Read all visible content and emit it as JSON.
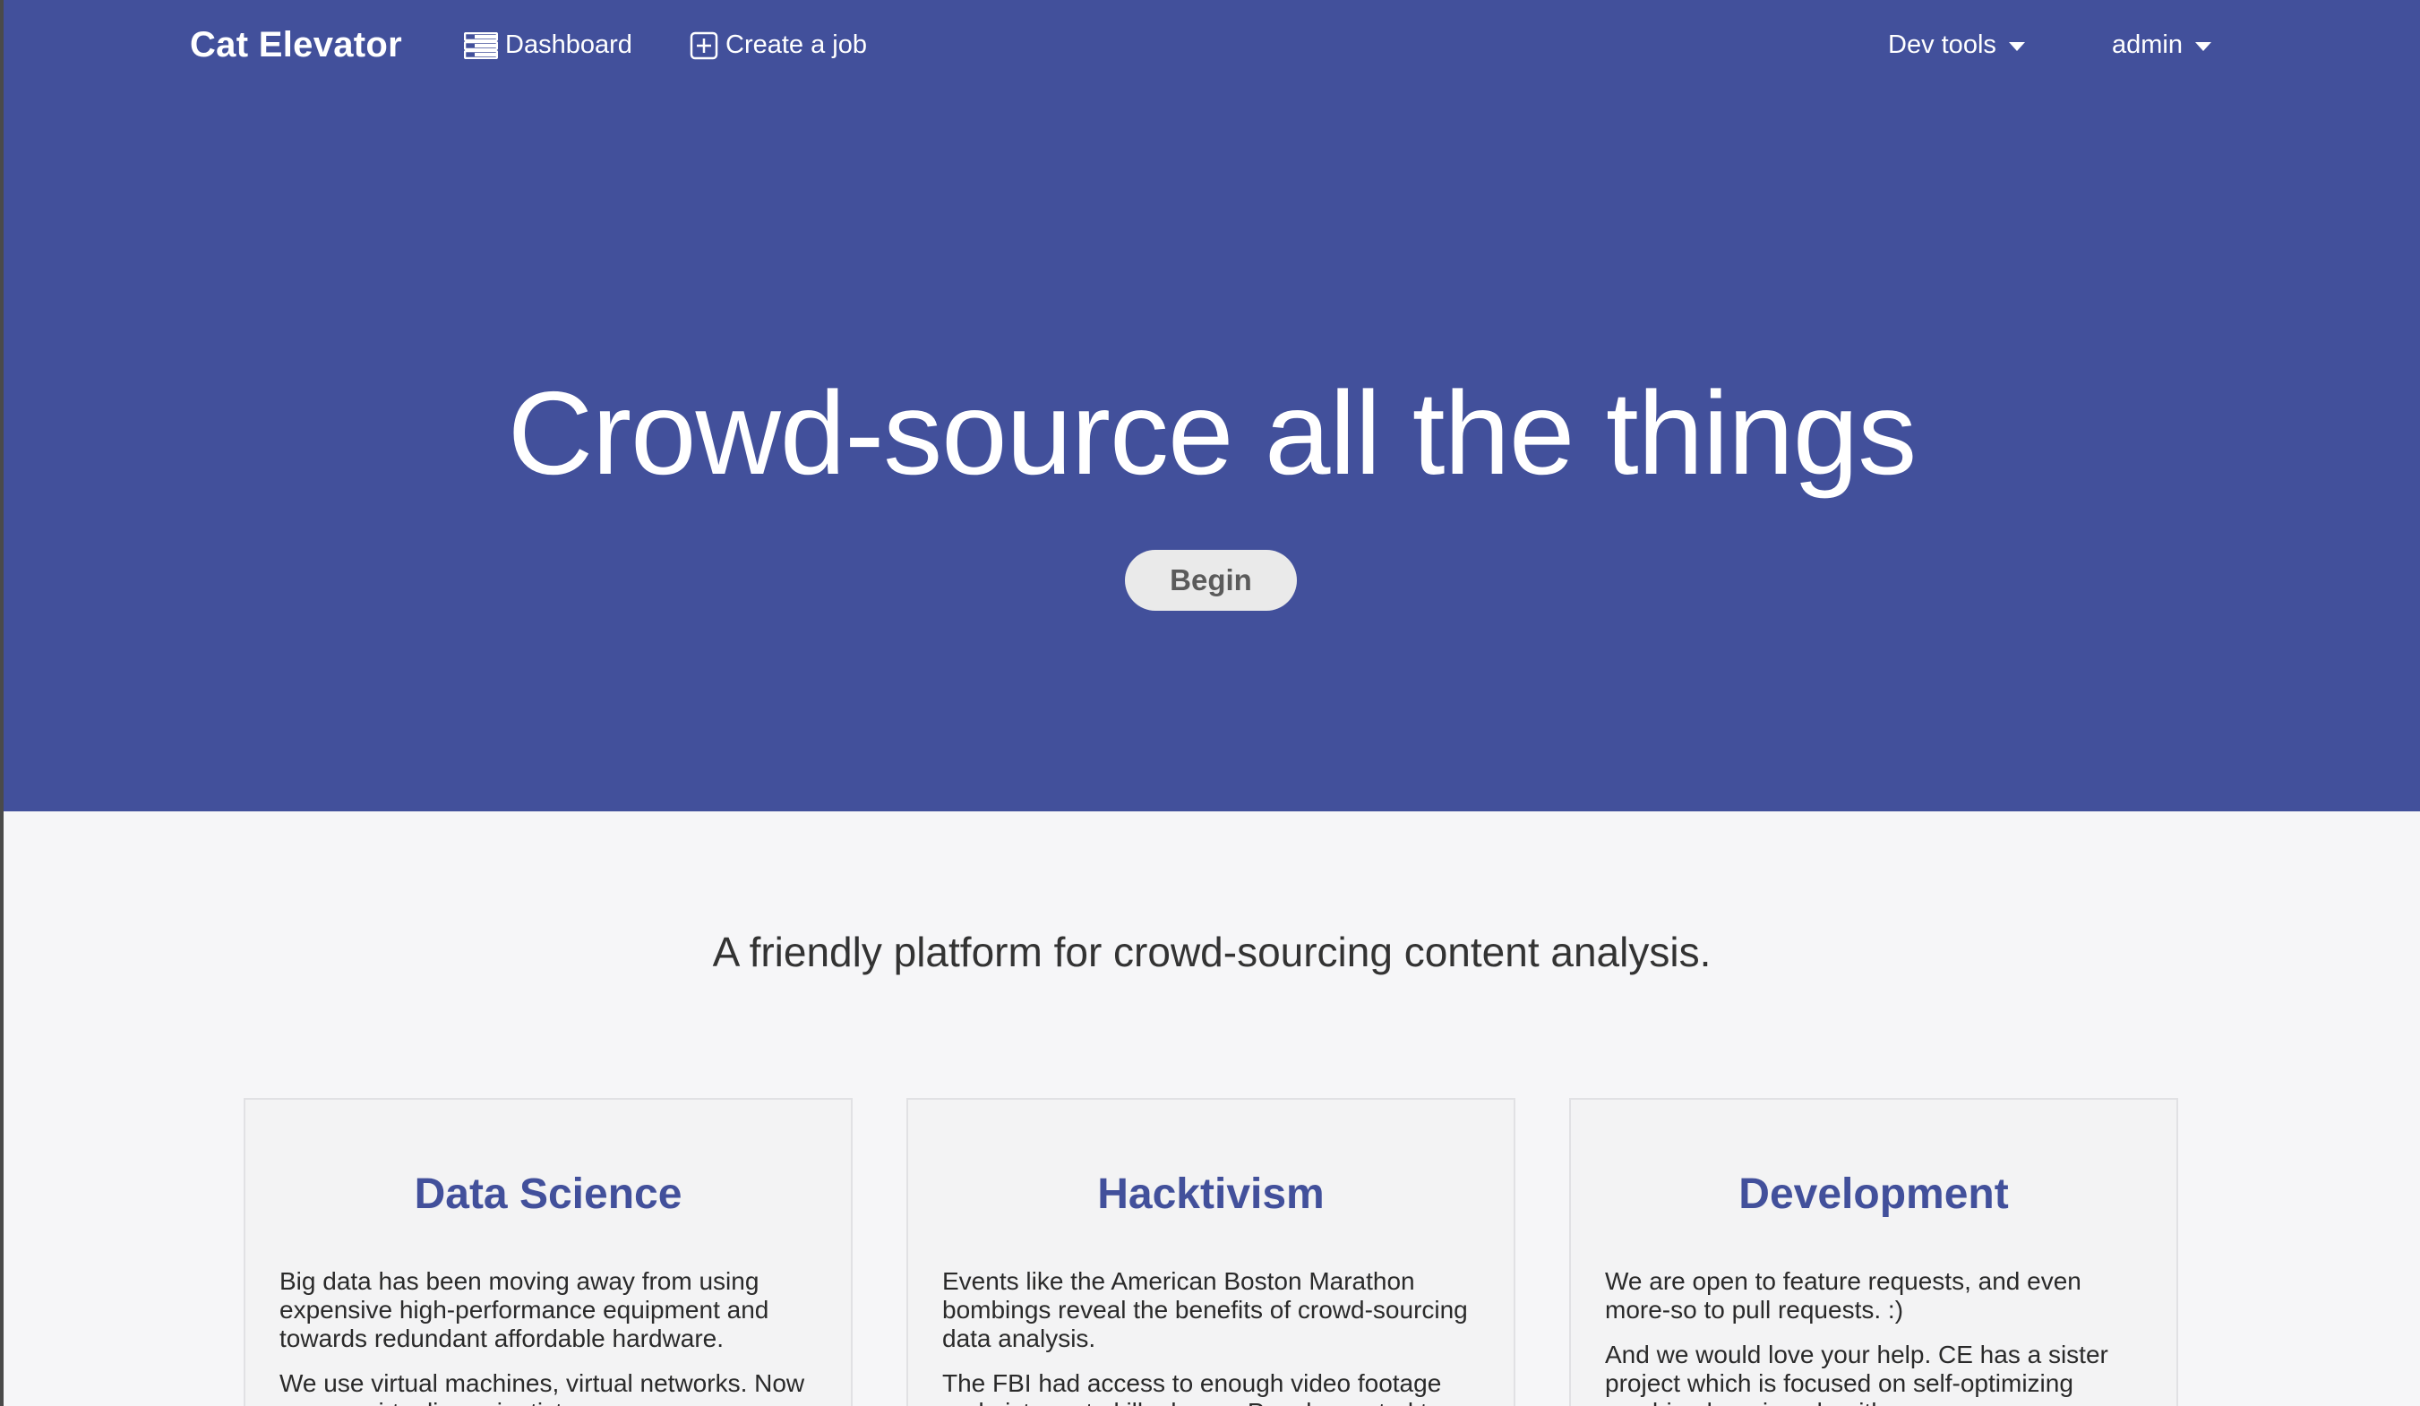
{
  "nav": {
    "brand": "Cat Elevator",
    "dashboard_label": "Dashboard",
    "create_job_label": "Create a job",
    "devtools_label": "Dev tools",
    "admin_label": "admin",
    "icons": {
      "dashboard": "list-icon",
      "create_job": "plus-square-icon",
      "dropdown": "caret-down-icon"
    }
  },
  "hero": {
    "title": "Crowd-source all the things",
    "button_label": "Begin"
  },
  "tagline": "A friendly platform for crowd-sourcing content analysis.",
  "cards": [
    {
      "title": "Data Science",
      "paragraphs": [
        "Big data has been moving away from using expensive high-performance equipment and towards redundant affordable hardware.",
        "We use virtual machines, virtual networks. Now we can virtualize scientists."
      ]
    },
    {
      "title": "Hacktivism",
      "paragraphs": [
        "Events like the American Boston Marathon bombings reveal the benefits of crowd-sourcing data analysis.",
        "The FBI had access to enough video footage and pictures to kill a horse. People wanted to"
      ]
    },
    {
      "title": "Development",
      "paragraphs": [
        "We are open to feature requests, and even more-so to pull requests. :)",
        "And we would love your help. CE has a sister project which is focused on self-optimizing machine learning algorithms."
      ]
    }
  ],
  "colors": {
    "primary": "#42509b",
    "background": "#f6f6f8",
    "button_bg": "#eaeaea",
    "button_text": "#5b5b5b"
  }
}
